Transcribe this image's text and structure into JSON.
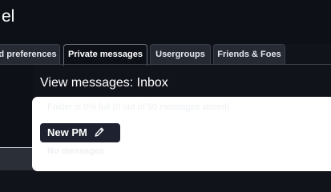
{
  "header": {
    "title": "el"
  },
  "tabs": [
    {
      "label": "d preferences",
      "active": false
    },
    {
      "label": "Private messages",
      "active": true
    },
    {
      "label": "Usergroups",
      "active": false
    },
    {
      "label": "Friends & Foes",
      "active": false
    }
  ],
  "main": {
    "heading": "View messages: Inbox",
    "folder_status": "Folder is 0% full (0 out of 50 messages stored)",
    "new_pm_label": "New PM",
    "new_pm_icon": "pencil-icon",
    "empty_text": "No messages"
  },
  "colors": {
    "page_background": "#11131a",
    "header_background": "#0d1016",
    "tab_background": "#262a33",
    "button_background": "#1e2230",
    "card_background": "#ffffff"
  }
}
